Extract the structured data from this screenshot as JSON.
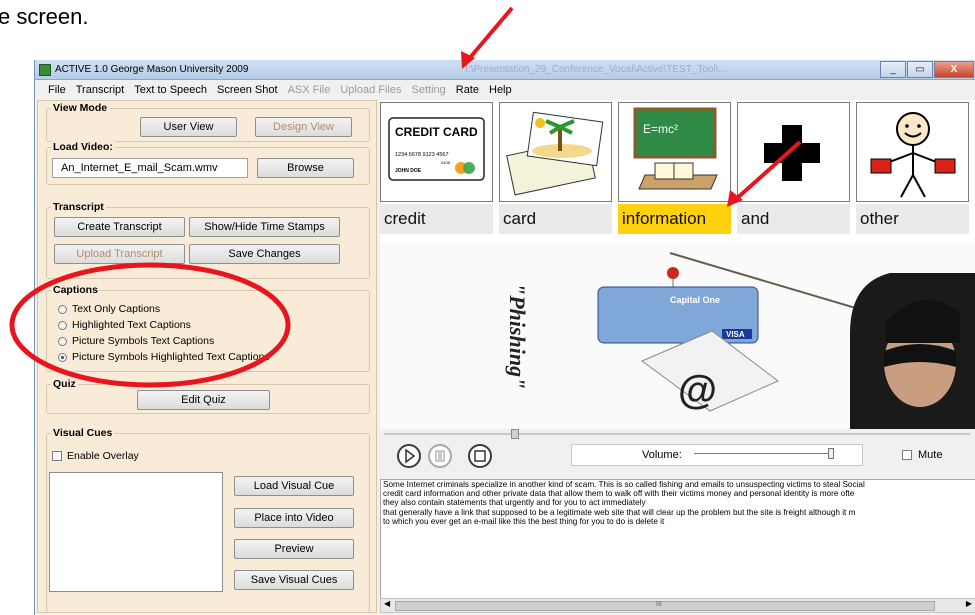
{
  "caption_fragment": "e screen.",
  "window": {
    "title": "ACTIVE 1.0 George Mason University 2009",
    "title_ghost": "I:\\Presentation_29_Conference_Vocal\\Active\\TEST_Tool\\...",
    "controls": [
      "_",
      "▭",
      "X"
    ]
  },
  "menu": [
    {
      "label": "File",
      "enabled": true
    },
    {
      "label": "Transcript",
      "enabled": true
    },
    {
      "label": "Text to Speech",
      "enabled": true
    },
    {
      "label": "Screen Shot",
      "enabled": true
    },
    {
      "label": "ASX File",
      "enabled": false
    },
    {
      "label": "Upload Files",
      "enabled": false
    },
    {
      "label": "Setting",
      "enabled": false
    },
    {
      "label": "Rate",
      "enabled": true
    },
    {
      "label": "Help",
      "enabled": true
    }
  ],
  "view_mode": {
    "label": "View Mode",
    "user_view": "User View",
    "design_view": "Design View"
  },
  "load_video": {
    "label": "Load Video:",
    "filename": "An_Internet_E_mail_Scam.wmv",
    "browse": "Browse"
  },
  "transcript_group": {
    "label": "Transcript",
    "create": "Create Transcript",
    "timestamps": "Show/Hide Time Stamps",
    "upload": "Upload Transcript",
    "save": "Save Changes"
  },
  "captions": {
    "label": "Captions",
    "options": [
      "Text Only Captions",
      "Highlighted Text Captions",
      "Picture Symbols Text Captions",
      "Picture Symbols Highlighted Text Captions"
    ],
    "selected": "Picture Symbols Highlighted Text Captions"
  },
  "quiz": {
    "label": "Quiz",
    "edit": "Edit Quiz"
  },
  "visual_cues": {
    "label": "Visual Cues",
    "enable_overlay": "Enable Overlay",
    "load": "Load Visual Cue",
    "place": "Place into Video",
    "preview": "Preview",
    "save": "Save Visual Cues"
  },
  "symbols": [
    {
      "name": "credit-card-symbol",
      "title": "CREDIT CARD",
      "number": "1234 5678 9123 4567",
      "holder": "JOHN DOE",
      "expiry": "0408"
    },
    {
      "name": "postcard-symbol"
    },
    {
      "name": "chalkboard-symbol",
      "text": "E=mc²"
    },
    {
      "name": "plus-symbol"
    },
    {
      "name": "person-holding-symbol"
    }
  ],
  "words": [
    {
      "text": "credit",
      "highlighted": false
    },
    {
      "text": "card",
      "highlighted": false
    },
    {
      "text": "information",
      "highlighted": true
    },
    {
      "text": "and",
      "highlighted": false
    },
    {
      "text": "other",
      "highlighted": false
    }
  ],
  "video": {
    "side_text": "\"Phishing\"",
    "card_brand": "Capital One",
    "card_logo": "VISA",
    "at_symbol": "@"
  },
  "player": {
    "volume_label": "Volume:",
    "mute_label": "Mute"
  },
  "transcript_text": [
    "Some Internet criminals specialize in another kind of scam. This is so called fishing and emails to unsuspecting victims to steal Social",
    "credit card information and other private data that allow them to walk off with their victims money and personal identity is more ofte",
    "they also contain statements that urgently and for you to act immediately",
    "that generally have a link that supposed to be a legitimate web site that will clear up the problem but the site is freight although it m",
    "to which you ever get an e-mail like this the best thing for you to do is delete it"
  ],
  "scroll_grip": "III",
  "colors": {
    "highlight": "#ffd10e",
    "annotation": "#e8151f",
    "panel": "#f8ecd8"
  }
}
